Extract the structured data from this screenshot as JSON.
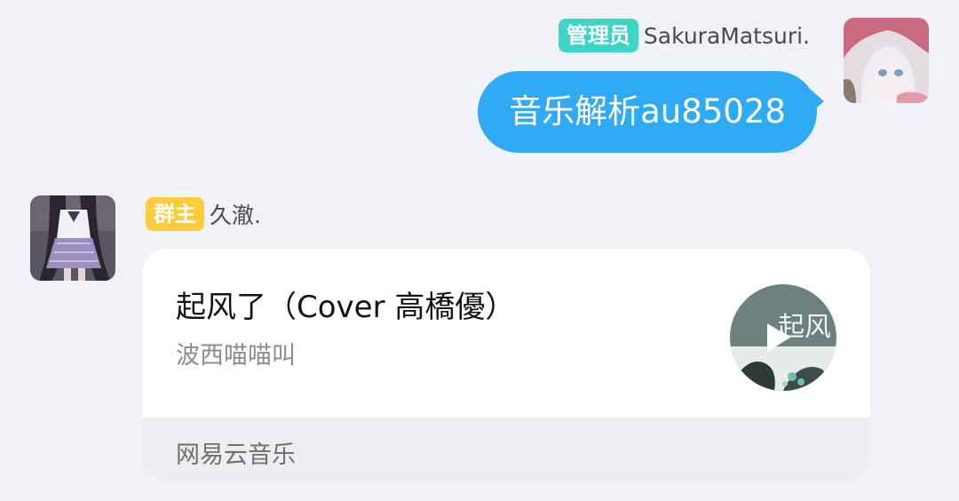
{
  "messages": {
    "sent": {
      "role_badge": "管理员",
      "sender_name": "SakuraMatsuri.",
      "text": "音乐解析au85028"
    },
    "received": {
      "role_badge": "群主",
      "sender_name": "久澈.",
      "music_card": {
        "title": "起风了（Cover 高橋優）",
        "artist": "波西喵喵叫",
        "source": "网易云音乐",
        "cover_overlay_text": "起风"
      }
    }
  },
  "colors": {
    "background": "#f1f2f7",
    "admin_badge": "#3dd6c6",
    "owner_badge": "#fccc3d",
    "bubble": "#2faaf5",
    "card_background": "#ffffff",
    "card_footer": "#eceef2"
  },
  "icons": [
    "play-icon"
  ]
}
